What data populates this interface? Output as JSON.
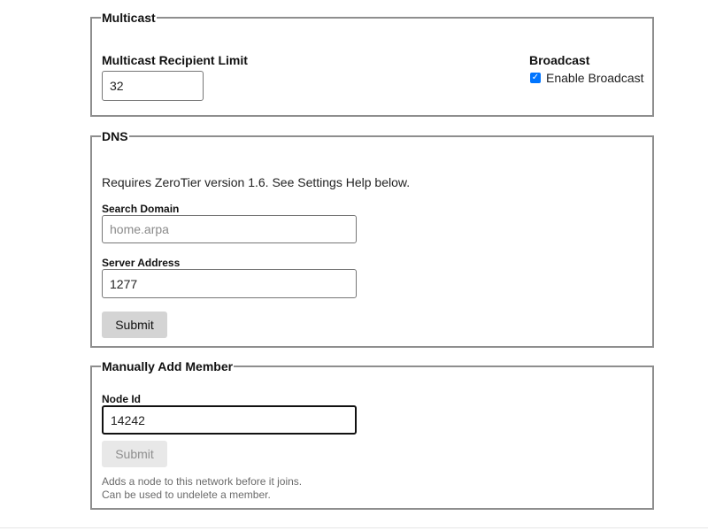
{
  "multicast": {
    "legend": "Multicast",
    "recipient_limit_label": "Multicast Recipient Limit",
    "recipient_limit_value": "32",
    "broadcast_label": "Broadcast",
    "enable_broadcast_label": "Enable Broadcast",
    "enable_broadcast_checked": true
  },
  "dns": {
    "legend": "DNS",
    "note": "Requires ZeroTier version 1.6. See Settings Help below.",
    "search_domain_label": "Search Domain",
    "search_domain_placeholder": "home.arpa",
    "search_domain_value": "",
    "server_address_label": "Server Address",
    "server_address_value": "1277",
    "submit_label": "Submit"
  },
  "member": {
    "legend": "Manually Add Member",
    "node_id_label": "Node Id",
    "node_id_value": "14242",
    "submit_label": "Submit",
    "help_line1": "Adds a node to this network before it joins.",
    "help_line2": "Can be used to undelete a member."
  },
  "colors": {
    "checkbox_accent": "#0075ff",
    "fieldset_border": "#8e8e8e",
    "button_enabled": "#d4d4d4",
    "button_disabled": "#e8e8e8"
  },
  "icons": {
    "checkmark": "checkmark-icon"
  }
}
